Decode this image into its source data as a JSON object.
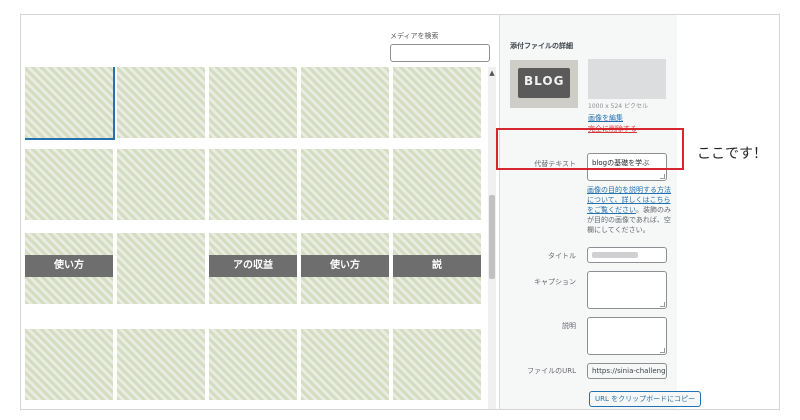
{
  "library": {
    "search_label": "メディアを検索",
    "search_value": "",
    "thumbnails": [
      {
        "row": 0,
        "col": 0,
        "selected": true,
        "banner": ""
      },
      {
        "row": 0,
        "col": 1,
        "selected": false,
        "banner": ""
      },
      {
        "row": 0,
        "col": 2,
        "selected": false,
        "banner": ""
      },
      {
        "row": 0,
        "col": 3,
        "selected": false,
        "banner": ""
      },
      {
        "row": 0,
        "col": 4,
        "selected": false,
        "banner": ""
      },
      {
        "row": 1,
        "col": 0,
        "selected": false,
        "banner": ""
      },
      {
        "row": 1,
        "col": 1,
        "selected": false,
        "banner": ""
      },
      {
        "row": 1,
        "col": 2,
        "selected": false,
        "banner": ""
      },
      {
        "row": 1,
        "col": 3,
        "selected": false,
        "banner": ""
      },
      {
        "row": 1,
        "col": 4,
        "selected": false,
        "banner": ""
      },
      {
        "row": 2,
        "col": 0,
        "selected": false,
        "banner": "使い方"
      },
      {
        "row": 2,
        "col": 1,
        "selected": false,
        "banner": ""
      },
      {
        "row": 2,
        "col": 2,
        "selected": false,
        "banner": "アの収益"
      },
      {
        "row": 2,
        "col": 3,
        "selected": false,
        "banner": "使い方"
      },
      {
        "row": 2,
        "col": 4,
        "selected": false,
        "banner": "説"
      },
      {
        "row": 3,
        "col": 0,
        "selected": false,
        "banner": ""
      },
      {
        "row": 3,
        "col": 1,
        "selected": false,
        "banner": ""
      },
      {
        "row": 3,
        "col": 2,
        "selected": false,
        "banner": ""
      },
      {
        "row": 3,
        "col": 3,
        "selected": false,
        "banner": ""
      },
      {
        "row": 3,
        "col": 4,
        "selected": false,
        "banner": ""
      }
    ]
  },
  "details": {
    "title": "添付ファイルの詳細",
    "preview_text": "BLOG",
    "dimensions": "1000 x 524 ピクセル",
    "edit_link": "画像を編集",
    "delete_link": "完全に削除する",
    "alt_label": "代替テキスト",
    "alt_value": "blogの基礎を学ぶ",
    "alt_help_link": "画像の目的を説明する方法について、詳しくはこちらをご覧ください",
    "alt_help_rest": "。装飾のみが目的の画像であれば、空欄にしてください。",
    "title_label": "タイトル",
    "caption_label": "キャプション",
    "caption_value": "",
    "description_label": "説明",
    "description_value": "",
    "url_label": "ファイルのURL",
    "url_value": "https://sinia-challenge.com",
    "copy_button": "URL をクリップボードにコピー"
  },
  "annotation": {
    "text": "ここです！",
    "highlight_color": "#d8262f"
  },
  "colors": {
    "link": "#2271b1",
    "delete": "#d63638",
    "sidebar_bg": "#f6f7f7"
  }
}
